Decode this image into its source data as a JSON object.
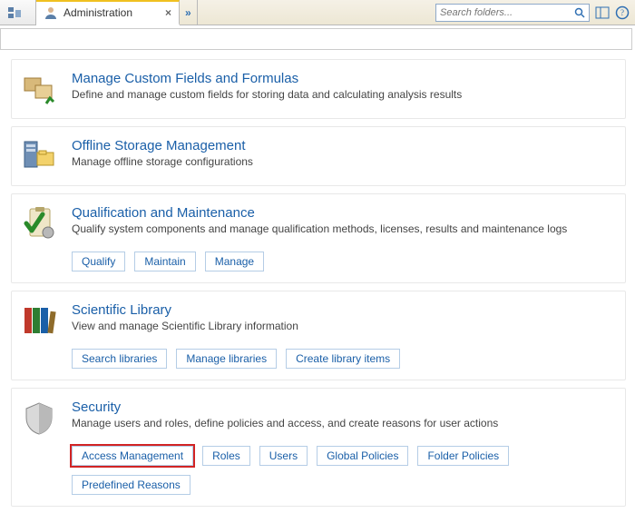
{
  "topbar": {
    "tabs": [
      {
        "label": "",
        "icon": "server-icon"
      },
      {
        "label": "Administration",
        "icon": "admin-icon",
        "active": true
      }
    ],
    "overflow_glyph": "»",
    "search_placeholder": "Search folders..."
  },
  "sections": [
    {
      "id": "custom-fields",
      "title": "Manage Custom Fields and Formulas",
      "desc": "Define and manage custom fields for storing data and calculating analysis results",
      "links": []
    },
    {
      "id": "offline-storage",
      "title": "Offline Storage Management",
      "desc": "Manage offline storage configurations",
      "links": []
    },
    {
      "id": "qualification",
      "title": "Qualification and Maintenance",
      "desc": "Qualify system components and manage qualification methods, licenses, results and maintenance logs",
      "links": [
        "Qualify",
        "Maintain",
        "Manage"
      ]
    },
    {
      "id": "scientific-library",
      "title": "Scientific Library",
      "desc": "View and manage Scientific Library information",
      "links": [
        "Search libraries",
        "Manage libraries",
        "Create library items"
      ]
    },
    {
      "id": "security",
      "title": "Security",
      "desc": "Manage users and roles, define policies and access, and create reasons for user actions",
      "links": [
        "Access Management",
        "Roles",
        "Users",
        "Global Policies",
        "Folder Policies",
        "Predefined Reasons"
      ],
      "highlighted_link": "Access Management"
    }
  ]
}
